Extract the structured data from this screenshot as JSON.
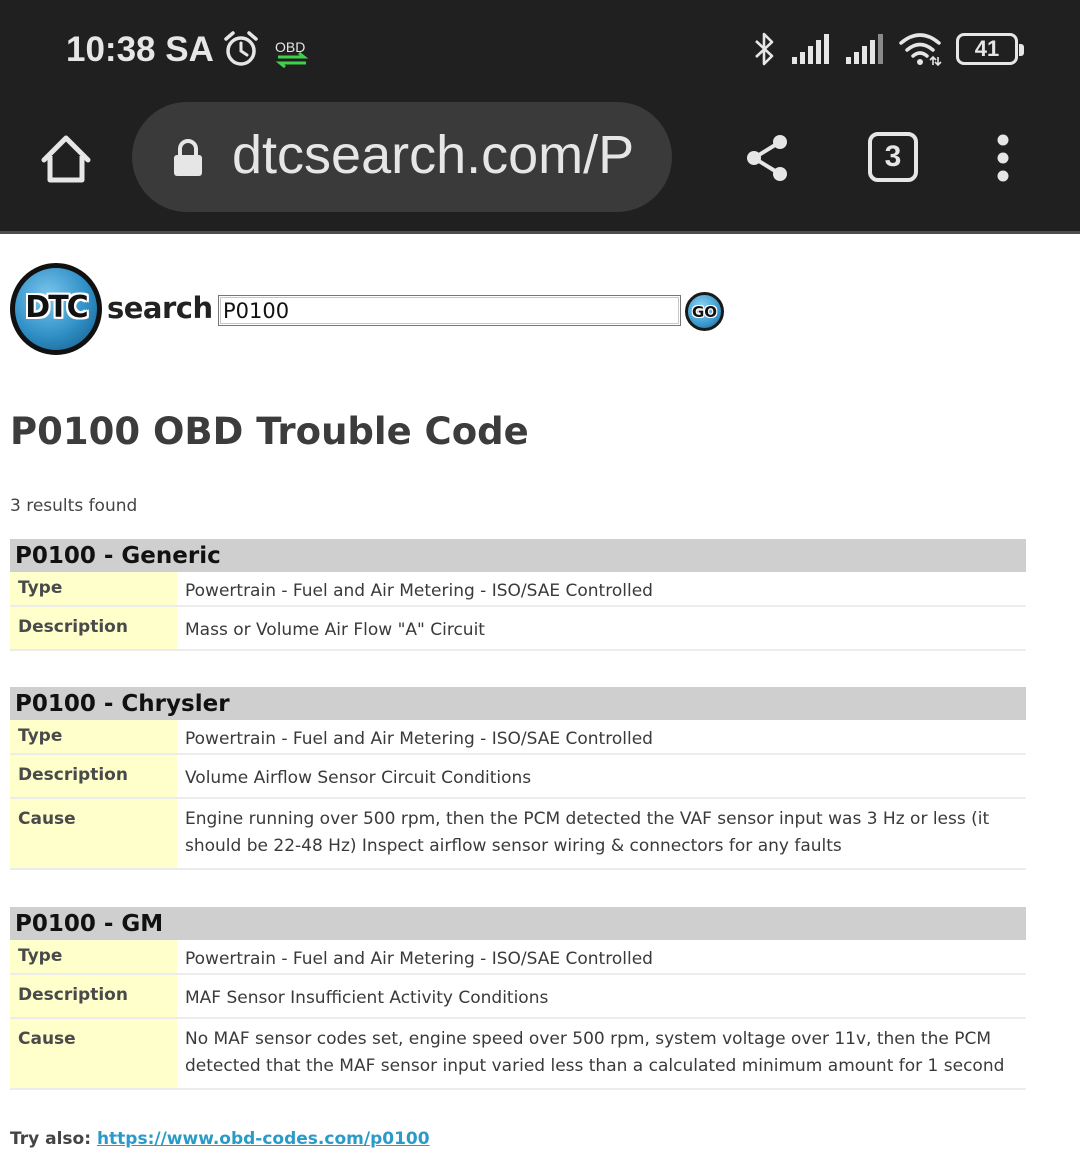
{
  "status_bar": {
    "time": "10:38 SA",
    "obd_badge": "OBD",
    "battery": "41",
    "icons": [
      "alarm-icon",
      "obd-sync-icon",
      "bluetooth-icon",
      "signal-1-icon",
      "signal-2-icon",
      "wifi-icon",
      "battery-icon"
    ]
  },
  "browser": {
    "url": "dtcsearch.com/P",
    "tab_count": "3",
    "icons": [
      "home-icon",
      "lock-icon",
      "share-icon",
      "tabs-icon",
      "more-vert-icon"
    ]
  },
  "site": {
    "logo_dtc": "DTC",
    "logo_search": "search",
    "search_value": "P0100",
    "go_label": "GO"
  },
  "page": {
    "title": "P0100 OBD Trouble Code",
    "results_count": "3 results found"
  },
  "results": [
    {
      "header": "P0100 - Generic",
      "rows": [
        {
          "label": "Type",
          "value": "Powertrain - Fuel and Air Metering - ISO/SAE Controlled"
        },
        {
          "label": "Description",
          "value": "Mass or Volume Air Flow \"A\" Circuit"
        }
      ]
    },
    {
      "header": "P0100 - Chrysler",
      "rows": [
        {
          "label": "Type",
          "value": "Powertrain - Fuel and Air Metering - ISO/SAE Controlled"
        },
        {
          "label": "Description",
          "value": "Volume Airflow Sensor Circuit Conditions"
        },
        {
          "label": "Cause",
          "value": "Engine running over 500 rpm, then the PCM detected the VAF sensor input was 3 Hz or less (it should be 22-48 Hz) Inspect airflow sensor wiring & connectors for any faults"
        }
      ]
    },
    {
      "header": "P0100 - GM",
      "rows": [
        {
          "label": "Type",
          "value": "Powertrain - Fuel and Air Metering - ISO/SAE Controlled"
        },
        {
          "label": "Description",
          "value": "MAF Sensor Insufficient Activity Conditions"
        },
        {
          "label": "Cause",
          "value": "No MAF sensor codes set, engine speed over 500 rpm, system voltage over 11v, then the PCM detected that the MAF sensor input varied less than a calculated minimum amount for 1 second"
        }
      ]
    }
  ],
  "footer": {
    "try_also_label": "Try also:",
    "try_also_link": "https://www.obd-codes.com/p0100"
  },
  "colors": {
    "chrome_bg": "#202020",
    "urlbar_bg": "#3a3a3a",
    "header_bg": "#cfcfcf",
    "label_bg": "#ffffcc",
    "link": "#2a9bc8",
    "obd_green": "#3fd14a"
  }
}
